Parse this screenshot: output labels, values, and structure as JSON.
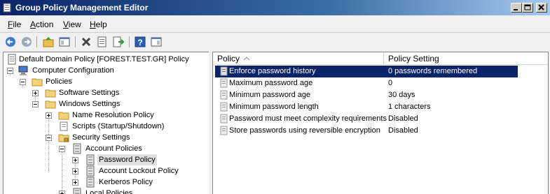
{
  "window": {
    "title": "Group Policy Management Editor"
  },
  "menubar": {
    "items": [
      "File",
      "Action",
      "View",
      "Help"
    ]
  },
  "toolbar": {
    "buttons": [
      "back-icon",
      "forward-icon",
      "up-folder-icon",
      "show-hide-tree-icon",
      "delete-icon",
      "properties-icon",
      "export-list-icon",
      "help-icon",
      "action-pane-icon"
    ]
  },
  "tree": {
    "nodes": [
      {
        "label": "Default Domain Policy [FOREST.TEST.GR] Policy",
        "icon": "policy-document-icon"
      },
      {
        "label": "Computer Configuration",
        "icon": "computer-icon"
      },
      {
        "label": "Policies",
        "icon": "folder-icon"
      },
      {
        "label": "Software Settings",
        "icon": "folder-icon"
      },
      {
        "label": "Windows Settings",
        "icon": "folder-icon"
      },
      {
        "label": "Name Resolution Policy",
        "icon": "folder-icon"
      },
      {
        "label": "Scripts (Startup/Shutdown)",
        "icon": "scripts-icon"
      },
      {
        "label": "Security Settings",
        "icon": "security-icon"
      },
      {
        "label": "Account Policies",
        "icon": "policy-book-icon"
      },
      {
        "label": "Password Policy",
        "icon": "policy-book-icon"
      },
      {
        "label": "Account Lockout Policy",
        "icon": "policy-book-icon"
      },
      {
        "label": "Kerberos Policy",
        "icon": "policy-book-icon"
      },
      {
        "label": "Local Policies",
        "icon": "policy-book-icon"
      }
    ]
  },
  "list": {
    "columns": [
      "Policy",
      "Policy Setting"
    ],
    "rows": [
      {
        "policy": "Enforce password history",
        "setting": "0 passwords remembered"
      },
      {
        "policy": "Maximum password age",
        "setting": "0"
      },
      {
        "policy": "Minimum password age",
        "setting": "30 days"
      },
      {
        "policy": "Minimum password length",
        "setting": "1 characters"
      },
      {
        "policy": "Password must meet complexity requirements",
        "setting": "Disabled"
      },
      {
        "policy": "Store passwords using reversible encryption",
        "setting": "Disabled"
      }
    ],
    "selected_row": "Enforce password history"
  },
  "colors": {
    "selection": "#0a246a",
    "title_bar": "#0a246a"
  }
}
